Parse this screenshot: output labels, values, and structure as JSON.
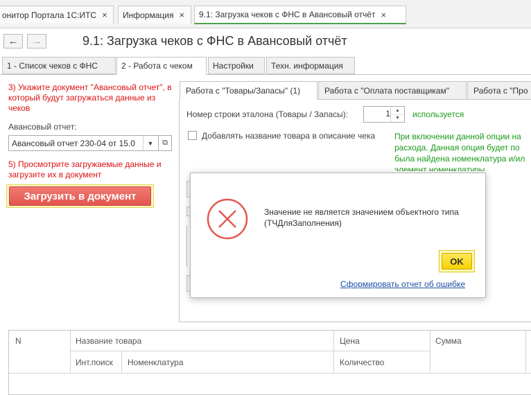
{
  "top_tabs": [
    {
      "label": "онитор Портала 1С:ИТС",
      "close": "×"
    },
    {
      "label": "Информация",
      "close": "×"
    },
    {
      "label": "9.1: Загрузка чеков с ФНС в Авансовый отчёт",
      "close": "×"
    }
  ],
  "nav": {
    "back": "←",
    "forward": "→"
  },
  "page_title": "9.1: Загрузка чеков с ФНС в Авансовый отчёт",
  "form_tabs": [
    "1 - Список чеков с ФНС",
    "2 - Работа с чеком",
    "Настройки",
    "Техн. информация"
  ],
  "left": {
    "step3": "3) Укажите документ \"Авансовый отчет\", в который будут загружаться данные из чеков",
    "report_label": "Авансовый отчет:",
    "report_value": "Авансовый отчет 230-04 от 15.0",
    "step5": "5) Просмотрите загружаемые данные и загрузите их в документ",
    "load_button": "Загрузить в документ"
  },
  "inner_tabs": [
    "Работа с \"Товары/Запасы\" (1)",
    "Работа с \"Оплата поставщикам\"",
    "Работа с \"Про"
  ],
  "inner": {
    "row_label": "Номер строки эталона (Товары / Запасы):",
    "row_value": "1",
    "row_status": "используется",
    "checkbox_label": "Добавлять название товара в описание чека",
    "hint": "При включении данной опции на расхода. Данная опция будет по была найдена номенклатура и/ил элемент номенклатуры."
  },
  "modal": {
    "message": "Значение не является значением объектного типа (ТЧДляЗаполнения)",
    "ok": "OK",
    "report_link": "Сформировать отчет об ошибке"
  },
  "table": {
    "col_n": "N",
    "col_name": "Название товара",
    "col_search": "Инт.поиск",
    "col_nomenclature": "Номенклатура",
    "col_price": "Цена",
    "col_qty": "Количество",
    "col_sum": "Сумма"
  }
}
